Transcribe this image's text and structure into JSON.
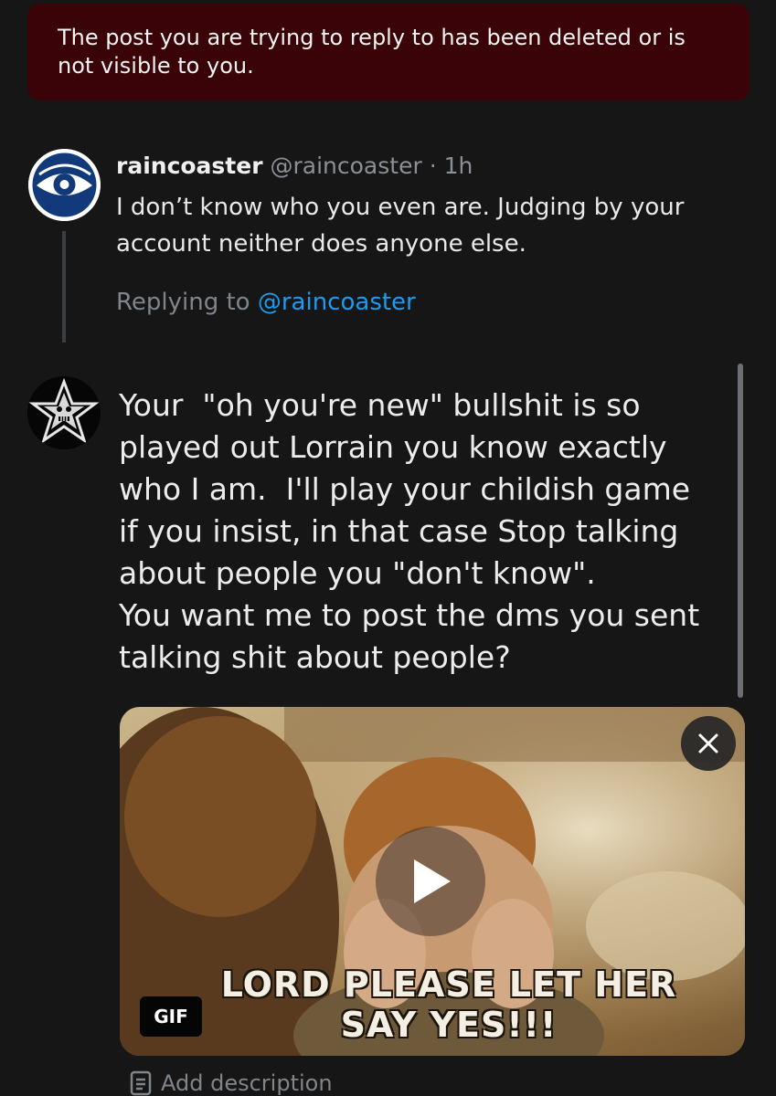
{
  "banner": {
    "message": "The post you are trying to reply to has been deleted or is not visible to you."
  },
  "reply": {
    "avatar_icon": "eye-logo-icon",
    "author": "raincoaster",
    "handle": "@raincoaster",
    "separator": " · ",
    "time": "1h",
    "text": "I don’t know who you even are. Judging by your account neither does anyone else.",
    "replying_label": "Replying to",
    "replying_handle": "@raincoaster"
  },
  "compose": {
    "avatar_icon": "star-skull-icon",
    "text": "Your  \"oh you're new\" bullshit is so\nplayed out Lorrain you know exactly\nwho I am.  I'll play your childish game\nif you insist, in that case Stop talking\nabout people you \"don't know\".\nYou want me to post the dms you sent\ntalking shit about people?"
  },
  "gif": {
    "caption_line1": "LORD PLEASE LET HER",
    "caption_line2": "SAY YES!!!",
    "badge": "GIF",
    "close_icon": "close-icon",
    "play_icon": "play-icon"
  },
  "add_description": {
    "label": "Add description",
    "icon": "description-icon"
  },
  "colors": {
    "background": "#161616",
    "banner": "#3a0307",
    "link": "#1d9bf0",
    "muted": "#8b9096"
  }
}
